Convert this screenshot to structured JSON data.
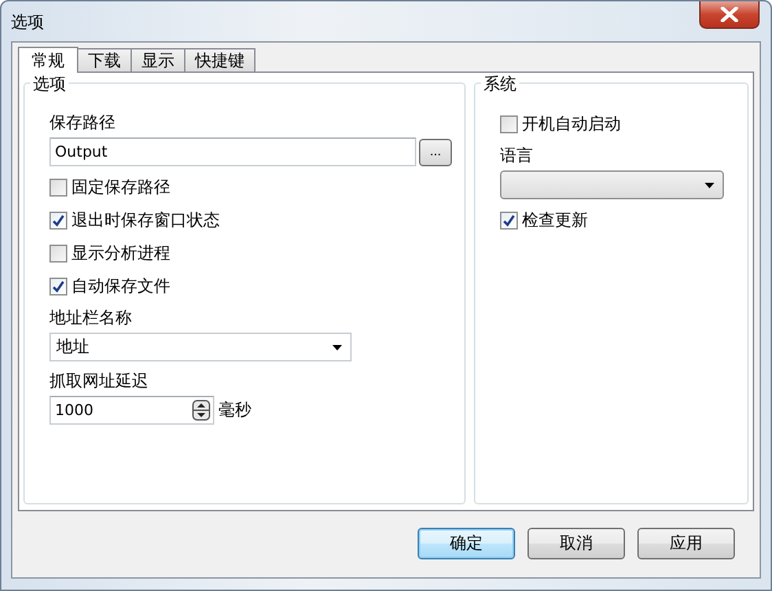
{
  "window": {
    "title": "选项"
  },
  "tabs": [
    {
      "label": "常规",
      "selected": true
    },
    {
      "label": "下载",
      "selected": false
    },
    {
      "label": "显示",
      "selected": false
    },
    {
      "label": "快捷键",
      "selected": false
    }
  ],
  "groups": [
    {
      "title": "选项",
      "items": [
        {
          "kind": "label",
          "text": "保存路径"
        },
        {
          "kind": "path",
          "value": "Output",
          "button": "..."
        },
        {
          "kind": "checkbox",
          "label": "固定保存路径",
          "checked": false
        },
        {
          "kind": "checkbox",
          "label": "退出时保存窗口状态",
          "checked": true
        },
        {
          "kind": "checkbox",
          "label": "显示分析进程",
          "checked": false
        },
        {
          "kind": "checkbox",
          "label": "自动保存文件",
          "checked": true
        },
        {
          "kind": "label",
          "text": "地址栏名称"
        },
        {
          "kind": "dropdown",
          "value": "地址"
        },
        {
          "kind": "label",
          "text": "抓取网址延迟"
        },
        {
          "kind": "spinner",
          "value": "1000",
          "unit": "毫秒"
        }
      ]
    },
    {
      "title": "系统",
      "items": [
        {
          "kind": "checkbox",
          "label": "开机自动启动",
          "checked": false
        },
        {
          "kind": "label",
          "text": "语言"
        },
        {
          "kind": "dropdown"
        },
        {
          "kind": "checkbox",
          "label": "检查更新",
          "checked": true
        }
      ]
    }
  ],
  "buttons": [
    {
      "label": "确定",
      "default": true
    },
    {
      "label": "取消",
      "default": false
    },
    {
      "label": "应用",
      "default": false
    }
  ]
}
